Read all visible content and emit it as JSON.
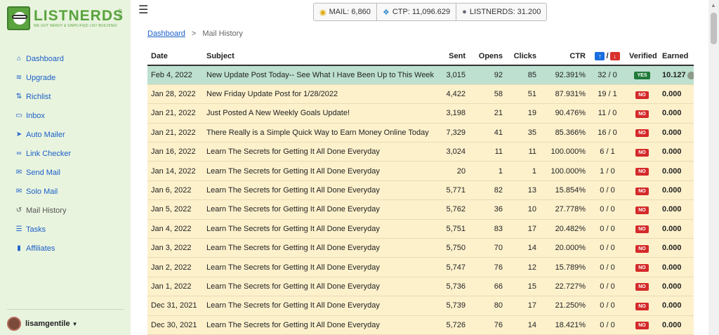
{
  "brand": {
    "title": "LISTNERDS",
    "tagline": "WE GOT NERDY & SIMPLIFIED LIST BUILDING!",
    "suffix": ".COM"
  },
  "sidebar": {
    "items": [
      {
        "label": "Dashboard",
        "icon": "home-icon"
      },
      {
        "label": "Upgrade",
        "icon": "layers-icon"
      },
      {
        "label": "Richlist",
        "icon": "sort-icon"
      },
      {
        "label": "Inbox",
        "icon": "inbox-icon"
      },
      {
        "label": "Auto Mailer",
        "icon": "paper-plane-icon"
      },
      {
        "label": "Link Checker",
        "icon": "link-icon"
      },
      {
        "label": "Send Mail",
        "icon": "envelope-icon"
      },
      {
        "label": "Solo Mail",
        "icon": "envelope-open-icon"
      },
      {
        "label": "Mail History",
        "icon": "history-icon"
      },
      {
        "label": "Tasks",
        "icon": "tasks-icon"
      },
      {
        "label": "Affiliates",
        "icon": "signal-icon"
      }
    ],
    "user": {
      "name": "lisamgentile"
    }
  },
  "topbar": {
    "mail": "MAIL: 6,860",
    "ctp": "CTP: 11,096.629",
    "listnerds": "LISTNERDS: 31.200"
  },
  "breadcrumb": {
    "root": "Dashboard",
    "separator": ">",
    "current": "Mail History"
  },
  "table": {
    "headers": {
      "date": "Date",
      "subject": "Subject",
      "sent": "Sent",
      "opens": "Opens",
      "clicks": "Clicks",
      "ctr": "CTR",
      "updown_sep": "/",
      "verified": "Verified",
      "earned": "Earned"
    },
    "rows": [
      {
        "date": "Feb 4, 2022",
        "subject": "New Update Post Today-- See What I Have Been Up to This Week",
        "sent": "3,015",
        "opens": "92",
        "clicks": "85",
        "ctr": "92.391%",
        "votes": "32 / 0",
        "verified": "YES",
        "earned": "10.127"
      },
      {
        "date": "Jan 28, 2022",
        "subject": "New Friday Update Post for 1/28/2022",
        "sent": "4,422",
        "opens": "58",
        "clicks": "51",
        "ctr": "87.931%",
        "votes": "19 / 1",
        "verified": "NO",
        "earned": "0.000"
      },
      {
        "date": "Jan 21, 2022",
        "subject": "Just Posted A New Weekly Goals Update!",
        "sent": "3,198",
        "opens": "21",
        "clicks": "19",
        "ctr": "90.476%",
        "votes": "11 / 0",
        "verified": "NO",
        "earned": "0.000"
      },
      {
        "date": "Jan 21, 2022",
        "subject": "There Really is a Simple Quick Way to Earn Money Online Today",
        "sent": "7,329",
        "opens": "41",
        "clicks": "35",
        "ctr": "85.366%",
        "votes": "16 / 0",
        "verified": "NO",
        "earned": "0.000"
      },
      {
        "date": "Jan 16, 2022",
        "subject": "Learn The Secrets for Getting It All Done Everyday",
        "sent": "3,024",
        "opens": "11",
        "clicks": "11",
        "ctr": "100.000%",
        "votes": "6 / 1",
        "verified": "NO",
        "earned": "0.000"
      },
      {
        "date": "Jan 14, 2022",
        "subject": "Learn The Secrets for Getting It All Done Everyday",
        "sent": "20",
        "opens": "1",
        "clicks": "1",
        "ctr": "100.000%",
        "votes": "1 / 0",
        "verified": "NO",
        "earned": "0.000"
      },
      {
        "date": "Jan 6, 2022",
        "subject": "Learn The Secrets for Getting It All Done Everyday",
        "sent": "5,771",
        "opens": "82",
        "clicks": "13",
        "ctr": "15.854%",
        "votes": "0 / 0",
        "verified": "NO",
        "earned": "0.000"
      },
      {
        "date": "Jan 5, 2022",
        "subject": "Learn The Secrets for Getting It All Done Everyday",
        "sent": "5,762",
        "opens": "36",
        "clicks": "10",
        "ctr": "27.778%",
        "votes": "0 / 0",
        "verified": "NO",
        "earned": "0.000"
      },
      {
        "date": "Jan 4, 2022",
        "subject": "Learn The Secrets for Getting It All Done Everyday",
        "sent": "5,751",
        "opens": "83",
        "clicks": "17",
        "ctr": "20.482%",
        "votes": "0 / 0",
        "verified": "NO",
        "earned": "0.000"
      },
      {
        "date": "Jan 3, 2022",
        "subject": "Learn The Secrets for Getting It All Done Everyday",
        "sent": "5,750",
        "opens": "70",
        "clicks": "14",
        "ctr": "20.000%",
        "votes": "0 / 0",
        "verified": "NO",
        "earned": "0.000"
      },
      {
        "date": "Jan 2, 2022",
        "subject": "Learn The Secrets for Getting It All Done Everyday",
        "sent": "5,747",
        "opens": "76",
        "clicks": "12",
        "ctr": "15.789%",
        "votes": "0 / 0",
        "verified": "NO",
        "earned": "0.000"
      },
      {
        "date": "Jan 1, 2022",
        "subject": "Learn The Secrets for Getting It All Done Everyday",
        "sent": "5,736",
        "opens": "66",
        "clicks": "15",
        "ctr": "22.727%",
        "votes": "0 / 0",
        "verified": "NO",
        "earned": "0.000"
      },
      {
        "date": "Dec 31, 2021",
        "subject": "Learn The Secrets for Getting It All Done Everyday",
        "sent": "5,739",
        "opens": "80",
        "clicks": "17",
        "ctr": "21.250%",
        "votes": "0 / 0",
        "verified": "NO",
        "earned": "0.000"
      },
      {
        "date": "Dec 30, 2021",
        "subject": "Learn The Secrets for Getting It All Done Everyday",
        "sent": "5,726",
        "opens": "76",
        "clicks": "14",
        "ctr": "18.421%",
        "votes": "0 / 0",
        "verified": "NO",
        "earned": "0.000"
      }
    ]
  },
  "colors": {
    "sidebar_bg": "#e9f4df",
    "brand_green": "#5aa33e",
    "link_blue": "#1a5fc7",
    "row_bg": "#fdf1cc",
    "row_highlight": "#bde0d0",
    "no_badge": "#d42a2a",
    "yes_badge": "#1f7a3a"
  }
}
